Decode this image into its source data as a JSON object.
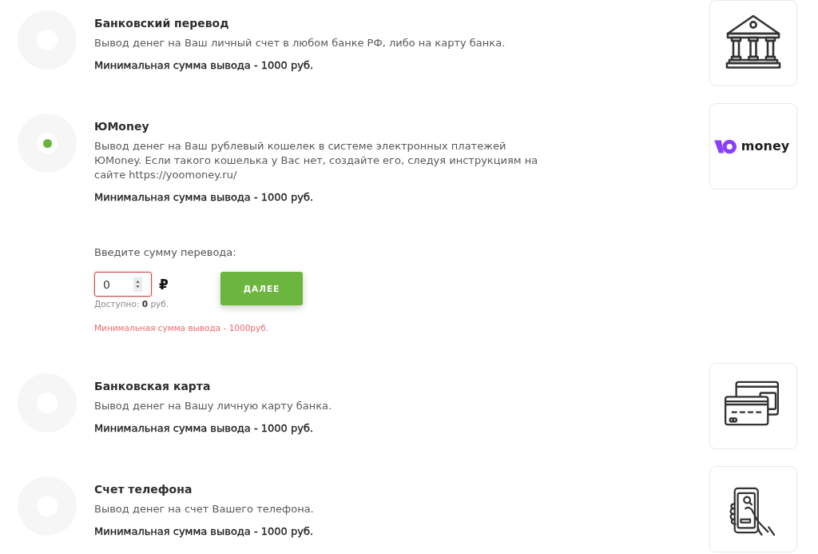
{
  "methods": [
    {
      "title": "Банковский перевод",
      "description": "Вывод денег на Ваш личный счет в любом банке РФ, либо на карту банка.",
      "minimum": "Минимальная сумма вывода - 1000 руб.",
      "selected": false,
      "logo": {
        "kind": "bank"
      }
    },
    {
      "title": "ЮMoney",
      "description": "Вывод денег на Ваш рублевый кошелек в системе электронных платежей ЮMoney. Если такого кошелька у Вас нет, создайте его, следуя инструкциям на сайте https://yoomoney.ru/",
      "minimum": "Минимальная сумма вывода - 1000 руб.",
      "selected": true,
      "logo": {
        "kind": "yoomoney",
        "text": "money"
      },
      "form": {
        "label": "Введите сумму перевода:",
        "value": "0",
        "invalid": true,
        "currency": "₽",
        "available": "Доступно: **0** руб.",
        "button": "ДАЛЕЕ",
        "error": "Минимальная сумма вывода - 1000руб."
      }
    },
    {
      "title": "Банковская карта",
      "description": "Вывод денег на Вашу личную карту банка.",
      "minimum": "Минимальная сумма вывода - 1000 руб.",
      "selected": false,
      "logo": {
        "kind": "cards"
      }
    },
    {
      "title": "Счет телефона",
      "description": "Вывод денег на счет Вашего телефона.",
      "minimum": "Минимальная сумма вывода - 1000 руб.",
      "selected": false,
      "logo": {
        "kind": "phone"
      }
    }
  ]
}
